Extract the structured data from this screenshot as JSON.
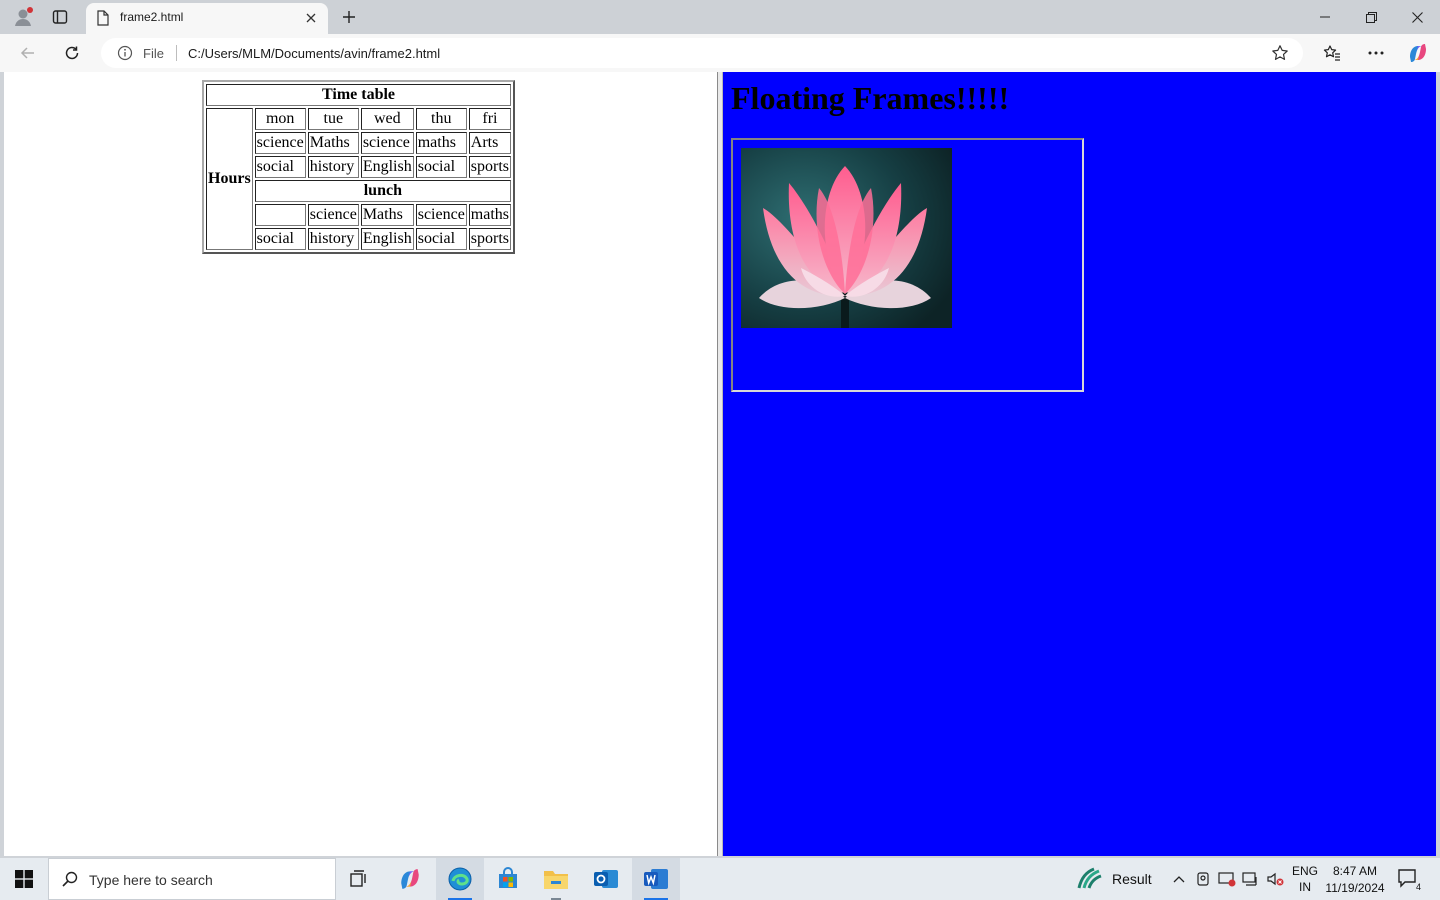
{
  "browser": {
    "tab_title": "frame2.html",
    "address_scheme": "File",
    "url": "C:/Users/MLM/Documents/avin/frame2.html"
  },
  "left_frame": {
    "timetable": {
      "caption": "Time table",
      "row_header": "Hours",
      "days": [
        "mon",
        "tue",
        "wed",
        "thu",
        "fri"
      ],
      "row1": [
        "science",
        "Maths",
        "science",
        "maths",
        "Arts"
      ],
      "row2": [
        "social",
        "history",
        "English",
        "social",
        "sports"
      ],
      "lunch": "lunch",
      "row3": [
        "",
        "science",
        "Maths",
        "science",
        "maths"
      ],
      "row4": [
        "social",
        "history",
        "English",
        "social",
        "sports"
      ]
    }
  },
  "right_frame": {
    "heading": "Floating Frames!!!!!",
    "background_color": "#0000ff",
    "iframe_image": "lotus-flower"
  },
  "taskbar": {
    "search_placeholder": "Type here to search",
    "weather_label": "Result",
    "language": "ENG",
    "region": "IN",
    "time": "8:47 AM",
    "date": "11/19/2024",
    "notification_count": "4"
  }
}
